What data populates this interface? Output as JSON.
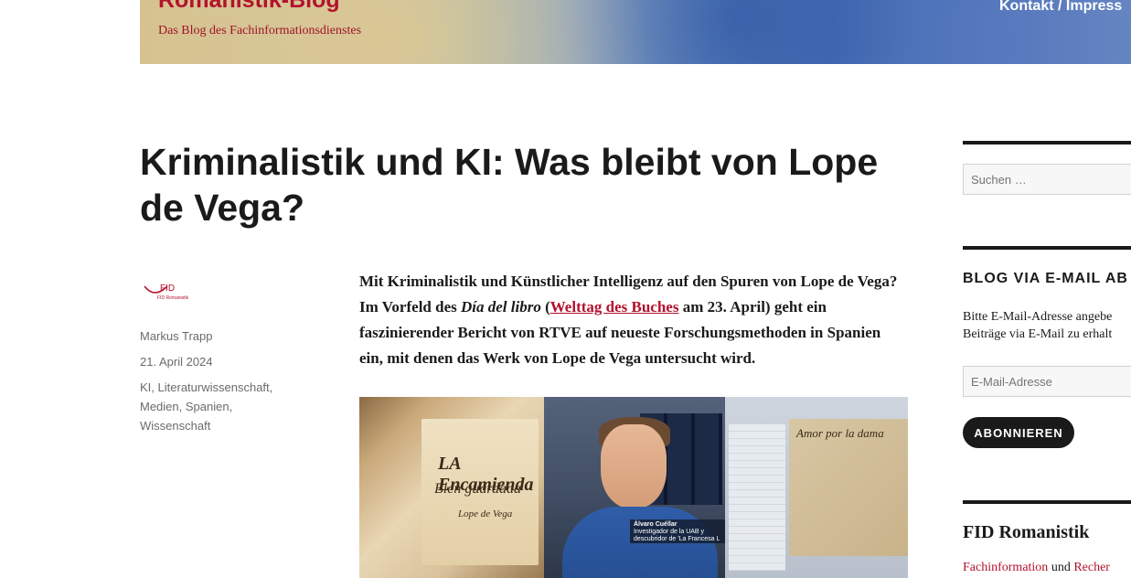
{
  "header": {
    "site_title": "Romanistik-Blog",
    "site_description": "Das Blog des Fachinformationsdienstes",
    "nav_link": "Kontakt / Impress"
  },
  "post": {
    "title": "Kriminalistik und KI: Was bleibt von Lope de Vega?",
    "author": "Markus Trapp",
    "date": "21. April 2024",
    "categories": [
      "KI",
      "Literaturwissenschaft",
      "Medien",
      "Spanien",
      "Wissenschaft"
    ],
    "avatar_label": "FID Romanistik",
    "intro": {
      "part1": "Mit Kriminalistik und Künstlicher Intelligenz auf den Spuren von Lope de Vega? Im Vorfeld des ",
      "italic": "Día del libro",
      "part2": " (",
      "link": "Welttag des Buches",
      "part3": " am 23. April) geht ein faszinierender Bericht von RTVE auf neueste Forschungsmethoden in Spanien ein, mit denen das Werk von Lope de Vega untersucht wird."
    },
    "image": {
      "manuscript_title": "LA Encamienda",
      "manuscript_subtitle": "Bien guardada",
      "manuscript_note": "Lope de Vega",
      "lower_third_name": "Álvaro Cuéllar",
      "lower_third_role": "Investigador de la UAB y descubridor de 'La Francesa L",
      "document_text": "Amor por la dama"
    }
  },
  "sidebar": {
    "search_placeholder": "Suchen …",
    "subscribe_title": "BLOG VIA E-MAIL AB",
    "subscribe_text": "Bitte E-Mail-Adresse angebe Beiträge via E-Mail zu erhalt",
    "email_placeholder": "E-Mail-Adresse",
    "subscribe_button": "ABONNIEREN",
    "fid_title": "FID Romanistik",
    "fid_link1": "Fachinformation",
    "fid_and": " und ",
    "fid_link2": "Recher"
  },
  "colors": {
    "accent": "#b3122d",
    "text": "#1a1a1a",
    "meta": "#6b6b6b"
  }
}
